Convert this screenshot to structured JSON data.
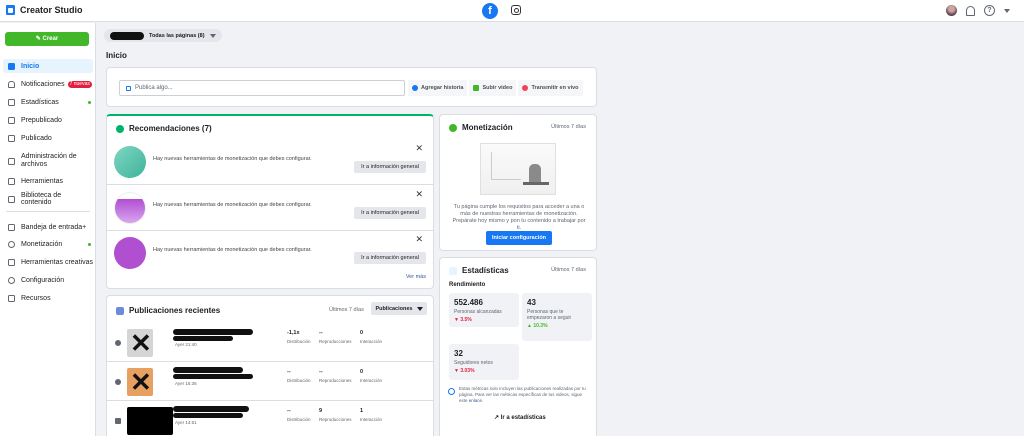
{
  "app": {
    "title": "Creator Studio"
  },
  "topbar": {
    "facebook_letter": "f",
    "help_glyph": "?"
  },
  "sidebar": {
    "create_label": "Crear",
    "items": [
      {
        "label": "Inicio"
      },
      {
        "label": "Notificaciones",
        "badge": "7 nuevas"
      },
      {
        "label": "Estadísticas"
      },
      {
        "label": "Prepublicado"
      },
      {
        "label": "Publicado"
      },
      {
        "label": "Administración de archivos"
      },
      {
        "label": "Herramientas"
      },
      {
        "label": "Biblioteca de contenido"
      },
      {
        "label": "Bandeja de entrada+"
      },
      {
        "label": "Monetización"
      },
      {
        "label": "Herramientas creativas"
      },
      {
        "label": "Configuración"
      },
      {
        "label": "Recursos"
      }
    ]
  },
  "page_selector": {
    "label": "Todas las páginas (8)"
  },
  "main": {
    "title": "Inicio"
  },
  "compose": {
    "placeholder": "Publica algo...",
    "actions": [
      "Agregar historia",
      "Subir video",
      "Transmitir en vivo"
    ]
  },
  "recommendations": {
    "title": "Recomendaciones (7)",
    "items": [
      {
        "text": "Hay nuevas herramientas de monetización que debes configurar.",
        "button": "Ir a información general"
      },
      {
        "text": "Hay nuevas herramientas de monetización que debes configurar.",
        "button": "Ir a información general"
      },
      {
        "text": "Hay nuevas herramientas de monetización que debes configurar.",
        "button": "Ir a información general"
      }
    ],
    "see_more": "Ver más",
    "close_glyph": "✕"
  },
  "recent": {
    "title": "Publicaciones recientes",
    "period": "Últimos 7 días",
    "filter": "Publicaciones",
    "rows": [
      {
        "time": "Ayer 21:40",
        "dist": "-1,1x",
        "repro": "--",
        "inter": "0"
      },
      {
        "time": "Ayer 15:36",
        "dist": "--",
        "repro": "--",
        "inter": "0"
      },
      {
        "time": "Ayer 14:51",
        "dist": "--",
        "repro": "9",
        "inter": "1"
      }
    ],
    "labels": {
      "dist": "Distribución",
      "repro": "Reproducciones",
      "inter": "Interacción"
    }
  },
  "monetization": {
    "title": "Monetización",
    "period": "Últimos 7 días",
    "text": "Tu página cumple los requisitos para acceder a una o más de nuestras herramientas de monetización. Prepárate hoy mismo y pon tu contenido a trabajar por ti.",
    "button": "Iniciar configuración"
  },
  "stats": {
    "title": "Estadísticas",
    "period": "Últimos 7 días",
    "section": "Rendimiento",
    "metrics": [
      {
        "value": "552.486",
        "label": "Personas alcanzadas",
        "change": "▼ 3.5%",
        "color": "#e41e3f"
      },
      {
        "value": "43",
        "label": "Personas que te empezaron a seguir",
        "change": "▲ 10.3%",
        "color": "#42b72a"
      },
      {
        "value": "32",
        "label": "Seguidores netos",
        "change": "▼ 3.03%",
        "color": "#e41e3f"
      }
    ],
    "note": "Estas métricas solo incluyen las publicaciones realizadas por tu página. Para ver las métricas específicas de tus videos, sigue este",
    "note_link": "enlace",
    "goto": "Ir a estadísticas"
  },
  "colors": {
    "accent": "#1877f2",
    "create": "#42b72a",
    "recommendation": "#00b36b"
  }
}
